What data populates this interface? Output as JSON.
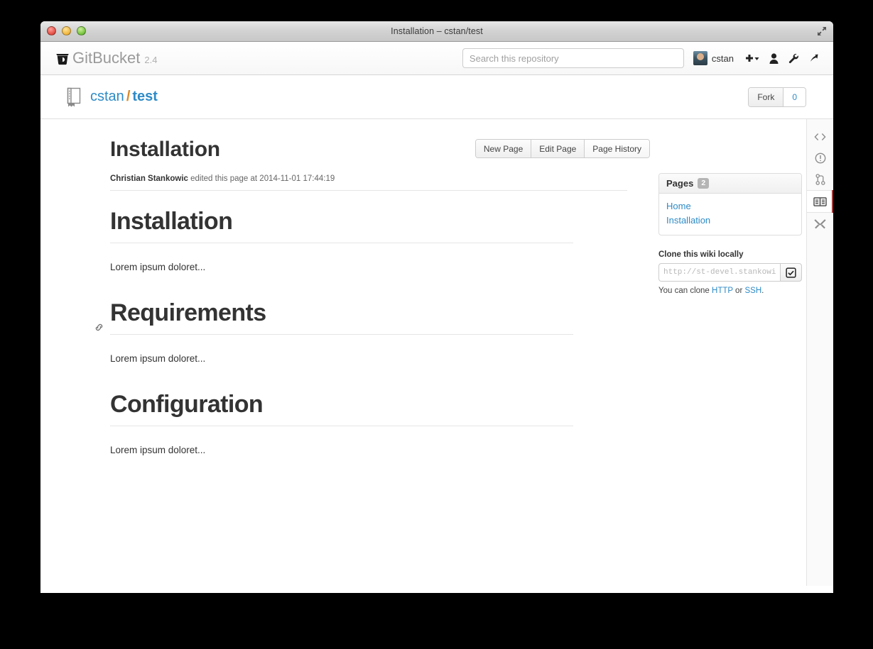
{
  "window": {
    "title": "Installation – cstan/test",
    "controls": {
      "close": "close",
      "minimize": "minimize",
      "zoom": "zoom"
    },
    "fullscreen_label": "Enter Full Screen"
  },
  "header": {
    "brand_name": "GitBucket",
    "version": "2.4",
    "search_placeholder": "Search this repository",
    "search_value": "",
    "user": "cstan",
    "icons": [
      {
        "name": "plus-dropdown-icon",
        "label": "Create new"
      },
      {
        "name": "user-icon",
        "label": "Your profile"
      },
      {
        "name": "wrench-icon",
        "label": "Administration"
      },
      {
        "name": "sign-out-icon",
        "label": "Sign out"
      }
    ]
  },
  "repo": {
    "owner": "cstan",
    "separator": "/",
    "name": "test",
    "fork_label": "Fork",
    "fork_count": "0"
  },
  "page": {
    "title": "Installation",
    "actions": [
      {
        "label": "New Page"
      },
      {
        "label": "Edit Page"
      },
      {
        "label": "Page History"
      }
    ],
    "byline_author": "Christian Stankowic",
    "byline_rest": " edited this page at 2014-11-01 17:44:19"
  },
  "content": {
    "sections": [
      {
        "heading": "Installation",
        "body": "Lorem ipsum doloret..."
      },
      {
        "heading": "Requirements",
        "body": "Lorem ipsum doloret..."
      },
      {
        "heading": "Configuration",
        "body": "Lorem ipsum doloret..."
      }
    ]
  },
  "sidebar": {
    "pages_title": "Pages",
    "pages_count": "2",
    "pages": [
      {
        "label": "Home"
      },
      {
        "label": "Installation"
      }
    ],
    "clone_title": "Clone this wiki locally",
    "clone_url": "http://st-devel.stankowic",
    "clone_note_prefix": "You can clone ",
    "clone_http": "HTTP",
    "clone_note_or": " or ",
    "clone_ssh": "SSH",
    "clone_note_suffix": "."
  },
  "rail": [
    {
      "name": "code-icon",
      "label": "Code",
      "active": false
    },
    {
      "name": "issues-icon",
      "label": "Issues",
      "active": false
    },
    {
      "name": "pull-request-icon",
      "label": "Pull requests",
      "active": false
    },
    {
      "name": "wiki-icon",
      "label": "Wiki",
      "active": true
    },
    {
      "name": "settings-tools-icon",
      "label": "Settings",
      "active": false
    }
  ],
  "colors": {
    "link": "#2e8bc7",
    "accent_orange": "#d88a2a",
    "active_marker": "#a23a3a",
    "text": "#333333"
  }
}
